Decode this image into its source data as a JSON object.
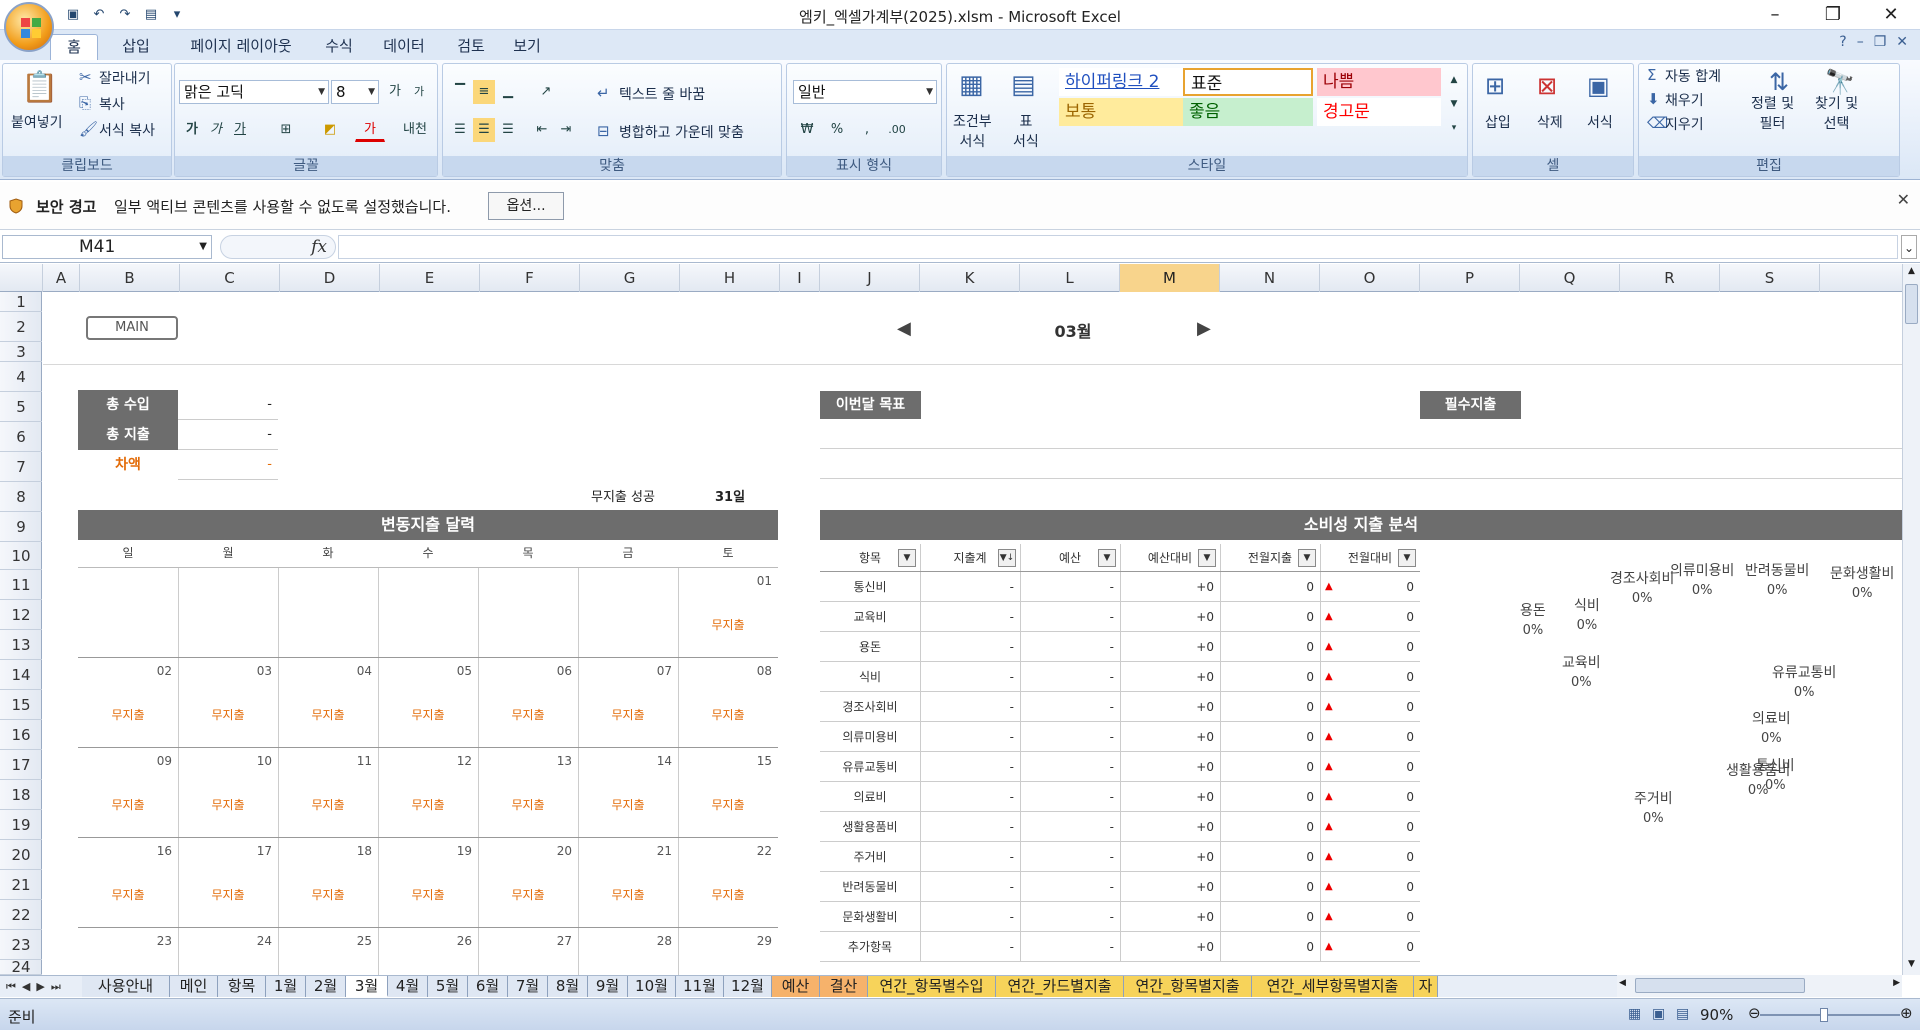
{
  "window": {
    "title": "엠키_엑셀가계부(2025).xlsm - Microsoft Excel"
  },
  "ribbon_tabs": [
    "홈",
    "삽입",
    "페이지 레이아웃",
    "수식",
    "데이터",
    "검토",
    "보기"
  ],
  "ribbon": {
    "clipboard": {
      "paste": "붙여넣기",
      "cut": "잘라내기",
      "copy": "복사",
      "format_painter": "서식 복사",
      "label": "클립보드"
    },
    "font": {
      "name": "맑은 고딕",
      "size": "8",
      "grow": "가",
      "shrink": "가",
      "bold": "가",
      "italic": "가",
      "underline": "가",
      "label": "글꼴",
      "fontcolor": "가",
      "phonetic": "내천"
    },
    "align": {
      "wrap": "텍스트 줄 바꿈",
      "merge": "병합하고 가운데 맞춤",
      "label": "맞춤"
    },
    "number": {
      "format": "일반",
      "currency": "₩",
      "percent": "%",
      "comma": ",",
      "inc": ".00",
      "label": "표시 형식"
    },
    "styles": {
      "conditional": "조건부\n서식",
      "table": "표\n서식",
      "cells": [
        {
          "text": "하이퍼링크 2",
          "bg": "#ffffff",
          "color": "#1f4fbf"
        },
        {
          "text": "표준",
          "bg": "#ffffff",
          "color": "#111111"
        },
        {
          "text": "나쁨",
          "bg": "#ffc7ce",
          "color": "#9c0006"
        },
        {
          "text": "보통",
          "bg": "#ffeb9c",
          "color": "#9c6500"
        },
        {
          "text": "좋음",
          "bg": "#c6efce",
          "color": "#006100"
        },
        {
          "text": "경고문",
          "bg": "#ffffff",
          "color": "#ff0000"
        }
      ],
      "label": "스타일"
    },
    "cells": {
      "insert": "삽입",
      "delete": "삭제",
      "format": "서식",
      "label": "셀"
    },
    "editing": {
      "autosum": "자동 합계",
      "fill": "채우기",
      "clear": "지우기",
      "sort": "정렬 및\n필터",
      "find": "찾기 및\n선택",
      "label": "편집"
    }
  },
  "security": {
    "title": "보안 경고",
    "message": "일부 액티브 콘텐츠를 사용할 수 없도록 설정했습니다.",
    "options": "옵션..."
  },
  "formula": {
    "namebox": "M41",
    "fx": "fx",
    "value": ""
  },
  "columns": [
    "A",
    "B",
    "C",
    "D",
    "E",
    "F",
    "G",
    "H",
    "I",
    "J",
    "K",
    "L",
    "M",
    "N",
    "O",
    "P",
    "Q",
    "R",
    "S"
  ],
  "selected_column": "M",
  "rows": [
    "1",
    "2",
    "3",
    "4",
    "5",
    "6",
    "7",
    "8",
    "9",
    "10",
    "11",
    "12",
    "13",
    "14",
    "15",
    "16",
    "17",
    "18",
    "19",
    "20",
    "21",
    "22",
    "23",
    "24"
  ],
  "sheet": {
    "main_button": "MAIN",
    "month": "03월",
    "summary": [
      {
        "label": "총 수입",
        "value": "-"
      },
      {
        "label": "총 지출",
        "value": "-"
      },
      {
        "label": "차액",
        "value": "-"
      }
    ],
    "no_spend_label": "무지출 성공",
    "no_spend_days": "31일",
    "goal_label": "이번달 목표",
    "fixed_label": "필수지출",
    "calendar_title": "변동지출 달력",
    "weekdays": [
      "일",
      "월",
      "화",
      "수",
      "목",
      "금",
      "토"
    ],
    "no_spend_mark": "무지출",
    "weeks": [
      [
        "",
        "",
        "",
        "",
        "",
        "",
        "01"
      ],
      [
        "02",
        "03",
        "04",
        "05",
        "06",
        "07",
        "08"
      ],
      [
        "09",
        "10",
        "11",
        "12",
        "13",
        "14",
        "15"
      ],
      [
        "16",
        "17",
        "18",
        "19",
        "20",
        "21",
        "22"
      ],
      [
        "23",
        "24",
        "25",
        "26",
        "27",
        "28",
        "29"
      ]
    ],
    "analysis_title": "소비성 지출 분석",
    "table_headers": [
      "항목",
      "지출계",
      "예산",
      "예산대비",
      "전월지출",
      "전월대비"
    ],
    "table_rows": [
      [
        "통신비",
        "-",
        "-",
        "+0",
        "0",
        "0"
      ],
      [
        "교육비",
        "-",
        "-",
        "+0",
        "0",
        "0"
      ],
      [
        "용돈",
        "-",
        "-",
        "+0",
        "0",
        "0"
      ],
      [
        "식비",
        "-",
        "-",
        "+0",
        "0",
        "0"
      ],
      [
        "경조사회비",
        "-",
        "-",
        "+0",
        "0",
        "0"
      ],
      [
        "의류미용비",
        "-",
        "-",
        "+0",
        "0",
        "0"
      ],
      [
        "유류교통비",
        "-",
        "-",
        "+0",
        "0",
        "0"
      ],
      [
        "의료비",
        "-",
        "-",
        "+0",
        "0",
        "0"
      ],
      [
        "생활용품비",
        "-",
        "-",
        "+0",
        "0",
        "0"
      ],
      [
        "주거비",
        "-",
        "-",
        "+0",
        "0",
        "0"
      ],
      [
        "반려동물비",
        "-",
        "-",
        "+0",
        "0",
        "0"
      ],
      [
        "문화생활비",
        "-",
        "-",
        "+0",
        "0",
        "0"
      ],
      [
        "추가항목",
        "-",
        "-",
        "+0",
        "0",
        "0"
      ]
    ],
    "pie_labels": [
      {
        "name": "경조사회비",
        "pct": "0%"
      },
      {
        "name": "의류미용비",
        "pct": "0%"
      },
      {
        "name": "반려동물비",
        "pct": "0%"
      },
      {
        "name": "문화생활비",
        "pct": "0%"
      },
      {
        "name": "용돈",
        "pct": "0%"
      },
      {
        "name": "식비",
        "pct": "0%"
      },
      {
        "name": "교육비",
        "pct": "0%"
      },
      {
        "name": "유류교통비",
        "pct": "0%"
      },
      {
        "name": "의료비",
        "pct": "0%"
      },
      {
        "name": "생활용품비",
        "pct": "0%"
      },
      {
        "name": "통신비",
        "pct": "0%"
      },
      {
        "name": "주거비",
        "pct": "0%"
      }
    ]
  },
  "sheet_tabs": [
    {
      "name": "사용안내",
      "kind": "normal"
    },
    {
      "name": "메인",
      "kind": "normal"
    },
    {
      "name": "항목",
      "kind": "normal"
    },
    {
      "name": "1월",
      "kind": "normal"
    },
    {
      "name": "2월",
      "kind": "normal"
    },
    {
      "name": "3월",
      "kind": "active"
    },
    {
      "name": "4월",
      "kind": "normal"
    },
    {
      "name": "5월",
      "kind": "normal"
    },
    {
      "name": "6월",
      "kind": "normal"
    },
    {
      "name": "7월",
      "kind": "normal"
    },
    {
      "name": "8월",
      "kind": "normal"
    },
    {
      "name": "9월",
      "kind": "normal"
    },
    {
      "name": "10월",
      "kind": "normal"
    },
    {
      "name": "11월",
      "kind": "normal"
    },
    {
      "name": "12월",
      "kind": "normal"
    },
    {
      "name": "예산",
      "kind": "orange"
    },
    {
      "name": "결산",
      "kind": "orange"
    },
    {
      "name": "연간_항목별수입",
      "kind": "yellow"
    },
    {
      "name": "연간_카드별지출",
      "kind": "yellow"
    },
    {
      "name": "연간_항목별지출",
      "kind": "yellow"
    },
    {
      "name": "연간_세부항목별지출",
      "kind": "yellow"
    },
    {
      "name": "자",
      "kind": "yellow"
    }
  ],
  "status": {
    "text": "준비",
    "zoom": "90%"
  }
}
